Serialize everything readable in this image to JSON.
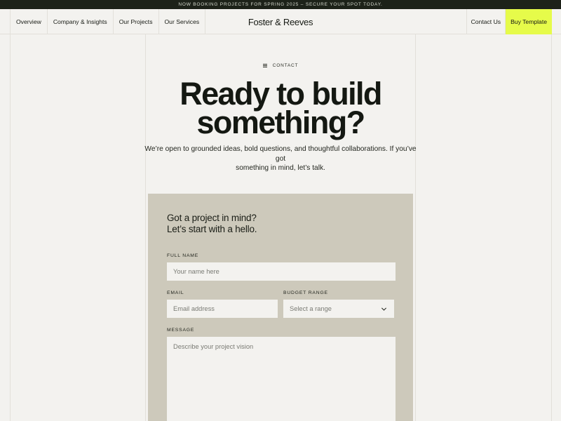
{
  "announcement": "NOW BOOKING PROJECTS FOR SPRING 2025 – SECURE YOUR SPOT TODAY.",
  "nav": {
    "left": [
      "Overview",
      "Company & Insights",
      "Our Projects",
      "Our Services"
    ],
    "brand": "Foster & Reeves",
    "contact": "Contact Us",
    "buy": "Buy Template"
  },
  "hero": {
    "eyebrow": "CONTACT",
    "headline_line1": "Ready to build",
    "headline_line2": "something?",
    "intro_line1": "We’re open to grounded ideas, bold questions, and thoughtful collaborations. If you’ve got",
    "intro_line2": "something in mind, let’s talk."
  },
  "form": {
    "heading_line1": "Got a project in mind?",
    "heading_line2": "Let’s start with a hello.",
    "full_name_label": "FULL NAME",
    "full_name_placeholder": "Your name here",
    "email_label": "EMAIL",
    "email_placeholder": "Email address",
    "budget_label": "BUDGET RANGE",
    "budget_value": "Select a range",
    "message_label": "MESSAGE",
    "message_placeholder": "Describe your project vision"
  },
  "colors": {
    "announcement_bg": "#1d2219",
    "accent": "#e6fb4a",
    "panel": "#cdc9bb",
    "page_bg": "#f3f2ef"
  },
  "icons": {
    "eyebrow": "lines-icon",
    "budget_select": "chevron-down-icon"
  }
}
